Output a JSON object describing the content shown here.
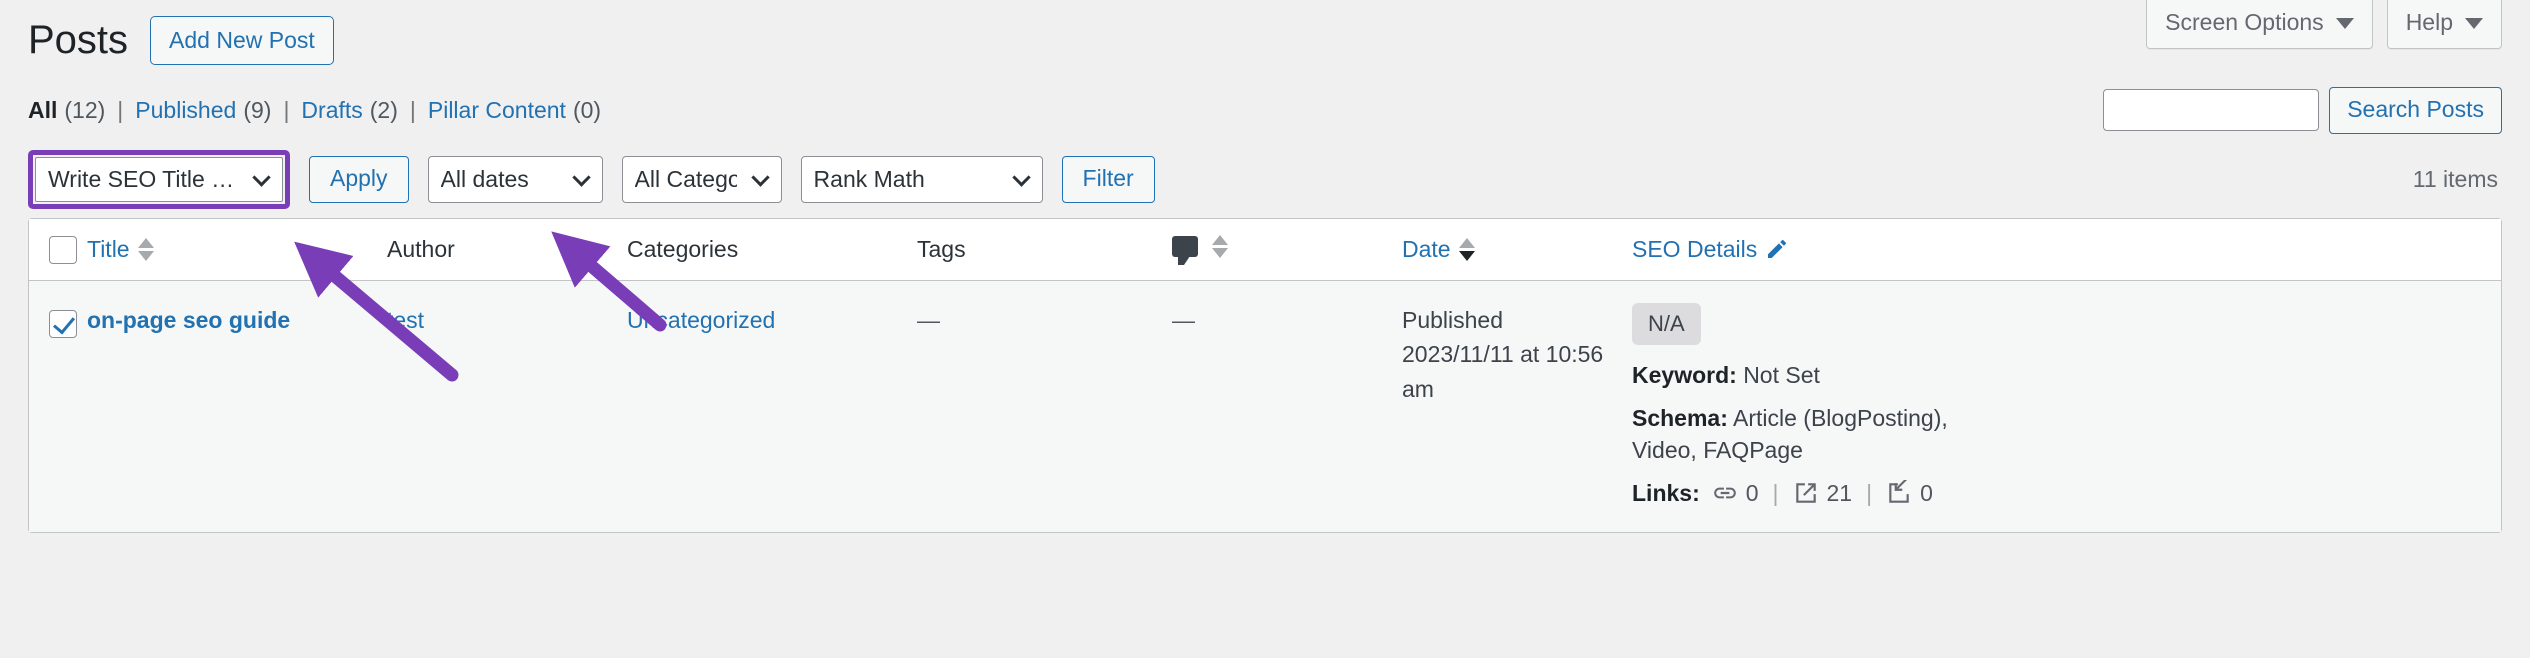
{
  "screen_meta": {
    "screen_options_label": "Screen Options",
    "help_label": "Help"
  },
  "header": {
    "page_title": "Posts",
    "add_new_label": "Add New Post"
  },
  "status_links": [
    {
      "label": "All",
      "count": "(12)",
      "current": true
    },
    {
      "label": "Published",
      "count": "(9)",
      "current": false
    },
    {
      "label": "Drafts",
      "count": "(2)",
      "current": false
    },
    {
      "label": "Pillar Content",
      "count": "(0)",
      "current": false
    }
  ],
  "search": {
    "value": "",
    "placeholder": "",
    "submit_label": "Search Posts"
  },
  "tablenav": {
    "bulk_action_selected": "Write SEO Title & Description",
    "apply_label": "Apply",
    "dates_selected": "All dates",
    "categories_selected": "All Categories",
    "seo_filter_selected": "Rank Math",
    "filter_label": "Filter",
    "displaying_num": "11 items",
    "highlight_color": "#7a3db8"
  },
  "table": {
    "columns": {
      "title": "Title",
      "author": "Author",
      "categories": "Categories",
      "tags": "Tags",
      "comments": "",
      "date": "Date",
      "seo_details": "SEO Details"
    },
    "rows": [
      {
        "checked": true,
        "title": "on-page seo guide",
        "author": "test",
        "categories": "Uncategorized",
        "tags": "—",
        "comments": "—",
        "date_status": "Published",
        "date_value": "2023/11/11 at 10:56 am",
        "seo": {
          "score_badge": "N/A",
          "keyword_label": "Keyword:",
          "keyword_value": "Not Set",
          "schema_label": "Schema:",
          "schema_value": "Article (BlogPosting), Video, FAQPage",
          "links_label": "Links:",
          "internal_links": "0",
          "external_links": "21",
          "incoming_links": "0"
        }
      }
    ]
  }
}
